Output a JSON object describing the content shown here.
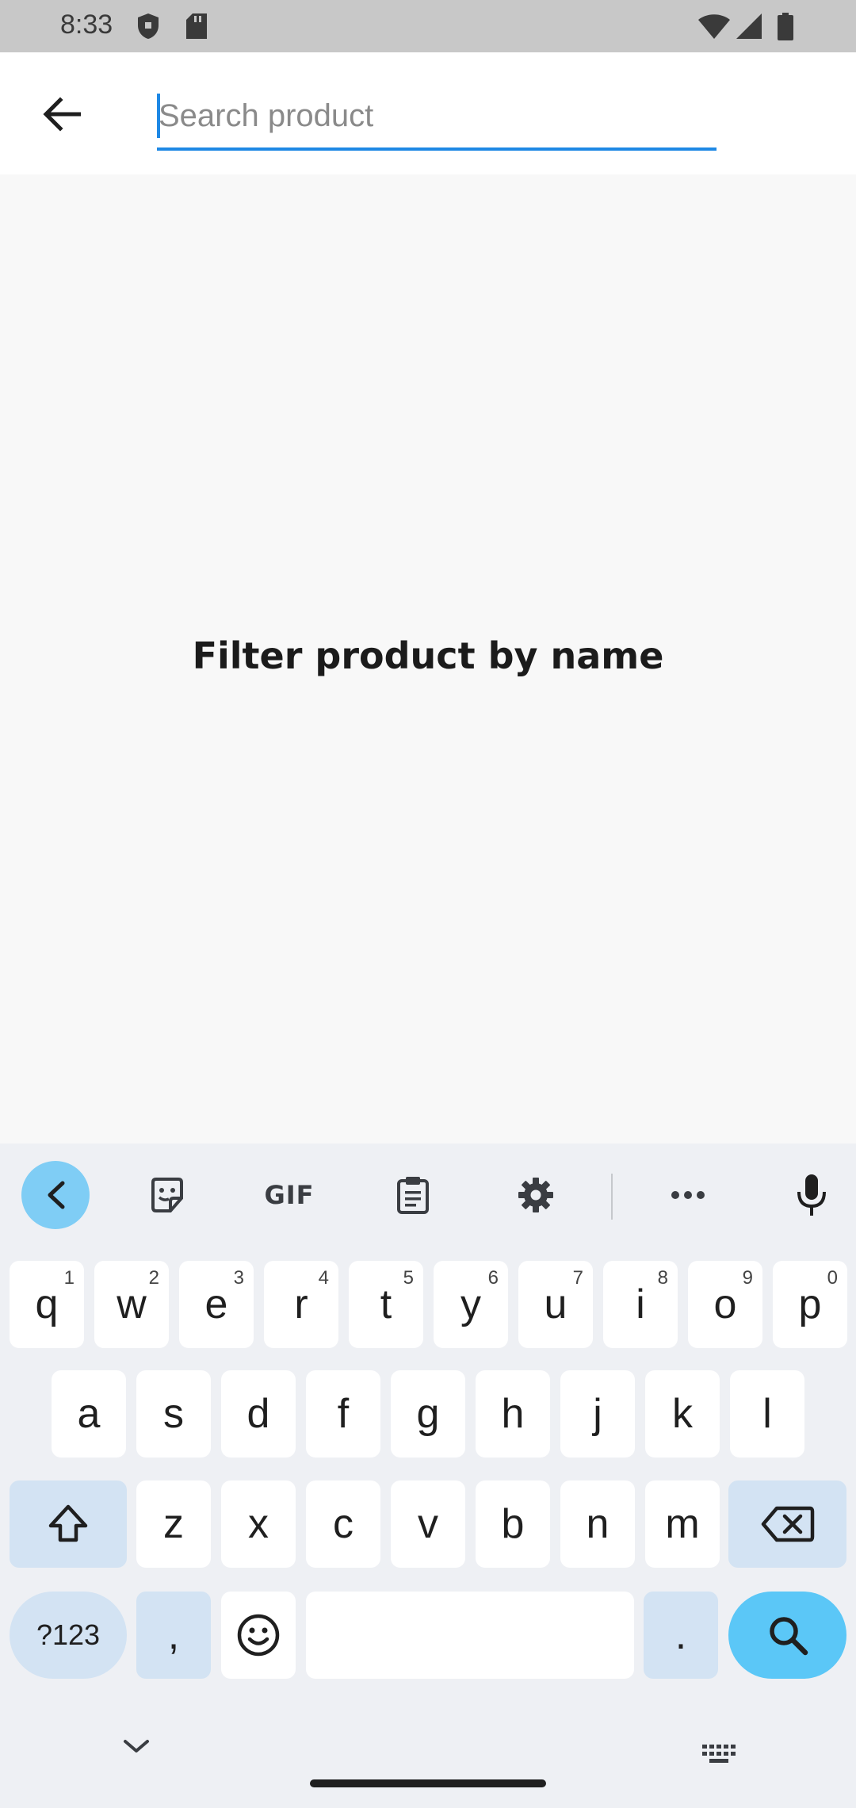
{
  "status_bar": {
    "time": "8:33"
  },
  "search": {
    "value": "",
    "placeholder": "Search product"
  },
  "main": {
    "empty_message": "Filter product by name"
  },
  "keyboard": {
    "toolbar": {
      "gif_label": "GIF"
    },
    "row1": [
      {
        "key": "q",
        "hint": "1"
      },
      {
        "key": "w",
        "hint": "2"
      },
      {
        "key": "e",
        "hint": "3"
      },
      {
        "key": "r",
        "hint": "4"
      },
      {
        "key": "t",
        "hint": "5"
      },
      {
        "key": "y",
        "hint": "6"
      },
      {
        "key": "u",
        "hint": "7"
      },
      {
        "key": "i",
        "hint": "8"
      },
      {
        "key": "o",
        "hint": "9"
      },
      {
        "key": "p",
        "hint": "0"
      }
    ],
    "row2": [
      "a",
      "s",
      "d",
      "f",
      "g",
      "h",
      "j",
      "k",
      "l"
    ],
    "row3": [
      "z",
      "x",
      "c",
      "v",
      "b",
      "n",
      "m"
    ],
    "symbols_label": "?123",
    "comma_label": ",",
    "period_label": "."
  }
}
